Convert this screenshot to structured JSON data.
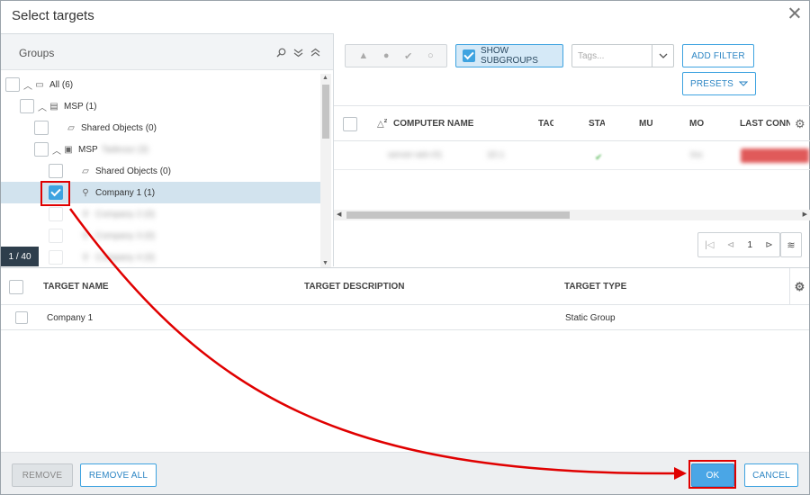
{
  "dialog": {
    "title": "Select targets"
  },
  "groups": {
    "title": "Groups",
    "counter": "1 / 40",
    "rows": [
      {
        "label": "All (6)",
        "blur": ""
      },
      {
        "label": "MSP (1)",
        "blur": ""
      },
      {
        "label": "Shared Objects (0)",
        "blur": ""
      },
      {
        "label": "MSP",
        "blur": "Tadeusz (3)"
      },
      {
        "label": "Shared Objects (0)",
        "blur": ""
      },
      {
        "label": "Company 1 (1)",
        "blur": ""
      },
      {
        "label": "",
        "blur": "Company 2 (0)"
      },
      {
        "label": "",
        "blur": "Company 3 (0)"
      },
      {
        "label": "",
        "blur": "Company 4 (0)"
      }
    ]
  },
  "toolbar": {
    "show_subgroups": "SHOW SUBGROUPS",
    "tags_placeholder": "Tags...",
    "add_filter": "ADD FILTER",
    "presets": "PRESETS"
  },
  "computers": {
    "columns": [
      "COMPUTER NAME",
      "TAG",
      "STA",
      "MU",
      "MO",
      "LAST CONN"
    ],
    "sort_index": "2",
    "row_blur": {
      "name": "server-win-01",
      "tag": "10.1",
      "mo": "Ins",
      "last": "Today 11:00"
    },
    "page": "1"
  },
  "targets": {
    "columns": [
      "TARGET NAME",
      "TARGET DESCRIPTION",
      "TARGET TYPE"
    ],
    "rows": [
      {
        "name": "Company 1",
        "description": "",
        "type": "Static Group"
      }
    ]
  },
  "footer": {
    "remove": "REMOVE",
    "remove_all": "REMOVE ALL",
    "ok": "OK",
    "cancel": "CANCEL"
  },
  "annotation": {
    "arrow_color": "#e00000"
  },
  "colors": {
    "accent": "#3ea3e0",
    "ok_bg": "#4aa6e6",
    "selected_row": "#d2e3ee"
  }
}
